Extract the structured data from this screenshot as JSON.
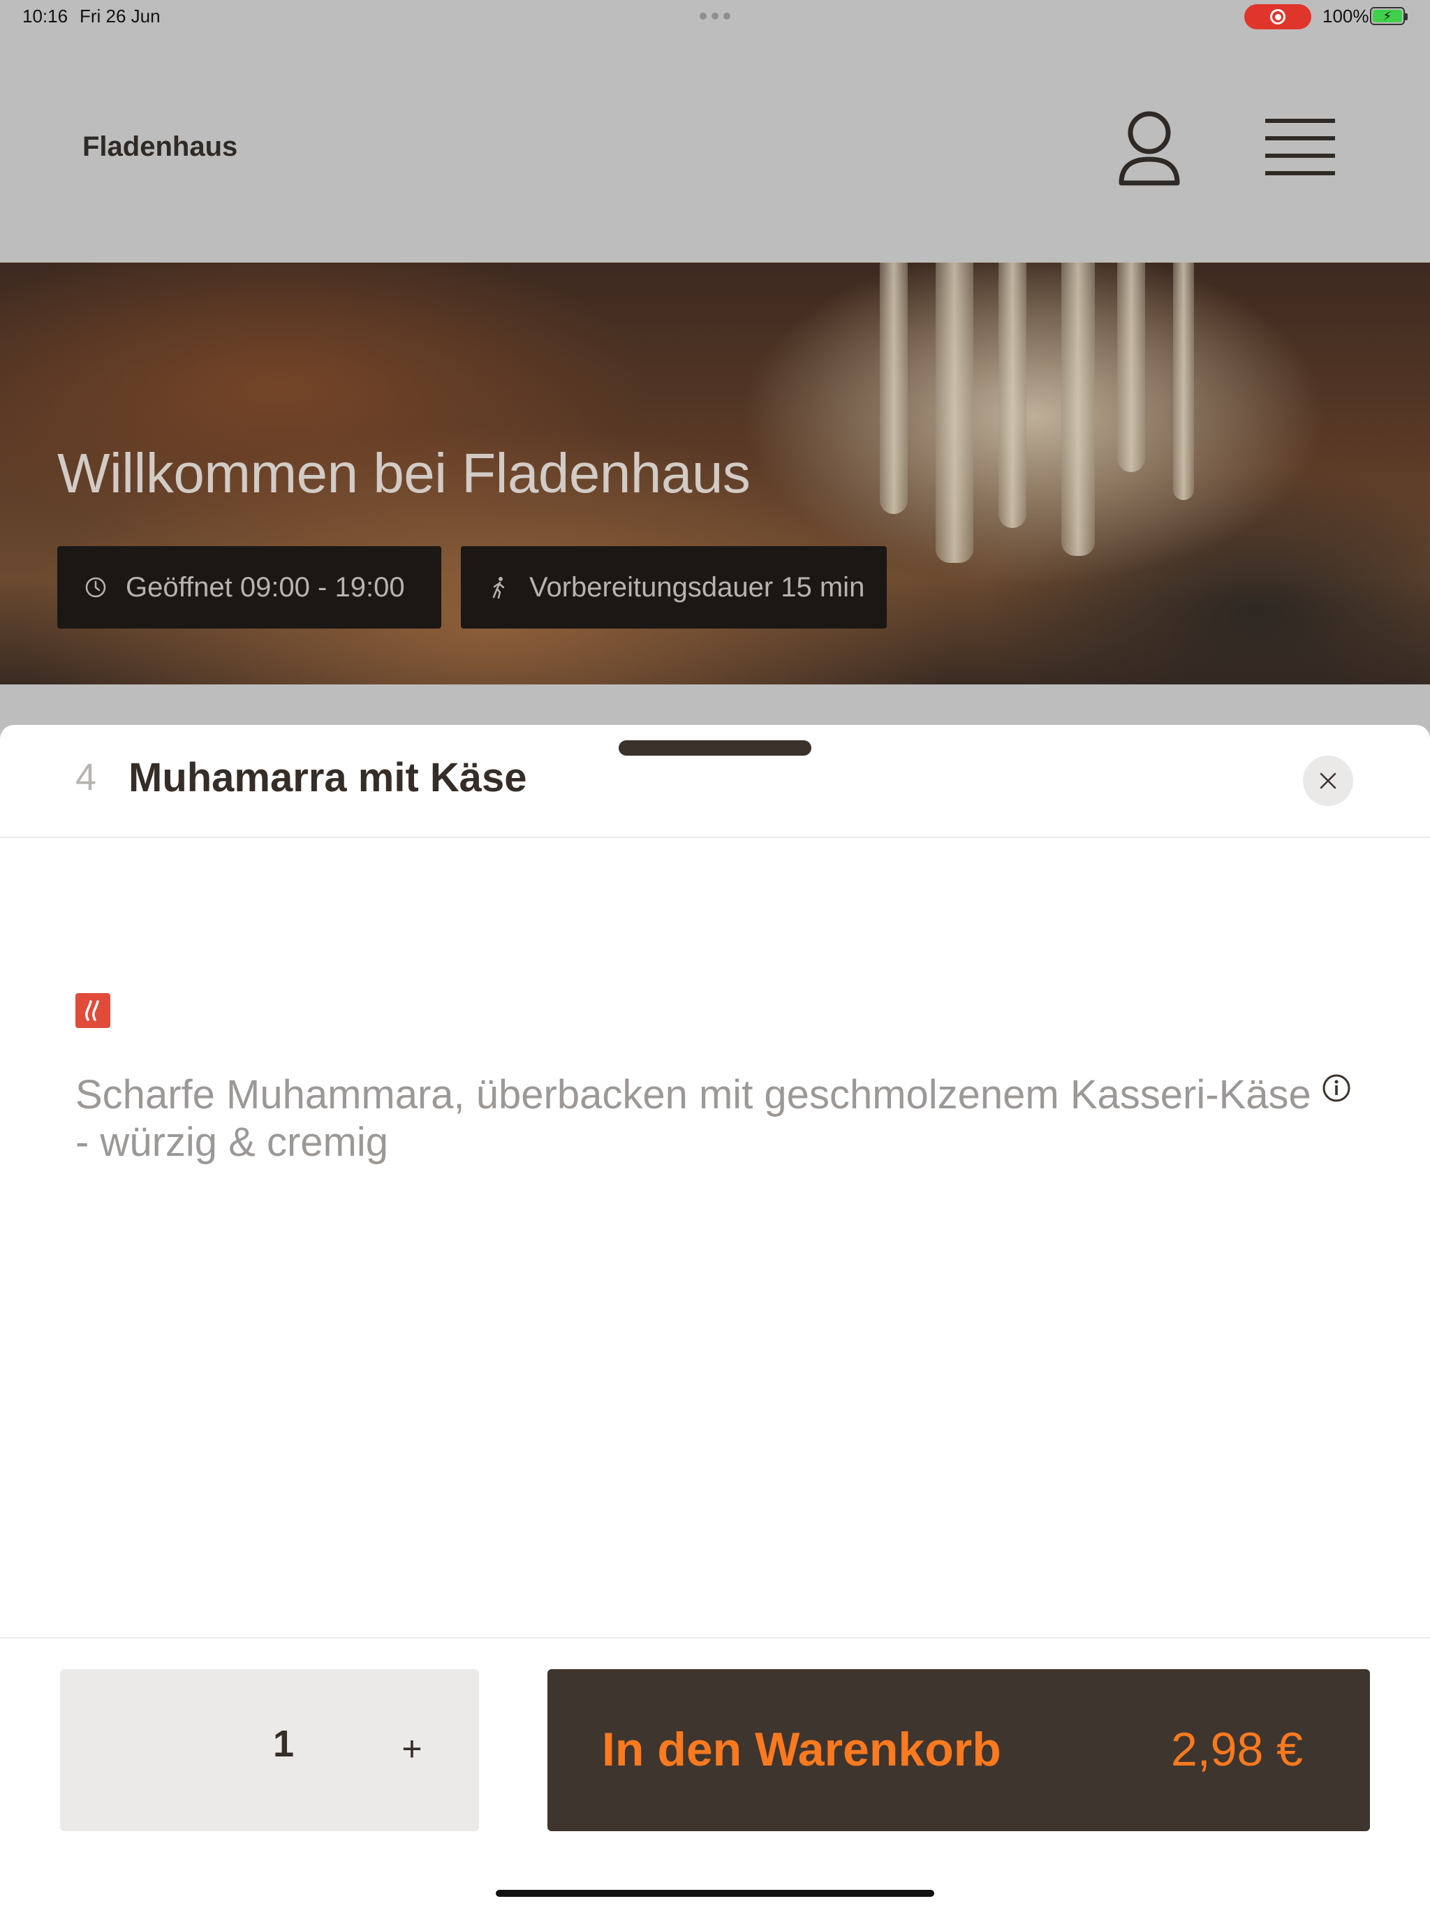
{
  "status_bar": {
    "time": "10:16",
    "date": "Fri 26 Jun",
    "battery_percent": "100%",
    "recording": true
  },
  "header": {
    "brand": "Fladenhaus",
    "icons": [
      "user-icon",
      "menu-icon"
    ]
  },
  "hero": {
    "title": "Willkommen bei Fladenhaus",
    "opening_hours": "Geöffnet 09:00 - 19:00",
    "prep_time": "Vorbereitungsdauer 15 min"
  },
  "product_sheet": {
    "number": "4",
    "title": "Muhamarra mit Käse",
    "description": "Scharfe Muhammara, überbacken mit geschmolzenem Kasseri-Käse - würzig & cremig",
    "badge_icon": "spicy-icon",
    "quantity": "1",
    "plus_label": "+",
    "add_to_cart_label": "In den Warenkorb",
    "price": "2,98 €"
  },
  "colors": {
    "accent_orange": "#ff7a1f",
    "button_dark": "#3e352f",
    "spicy_red": "#e04b3a",
    "record_red": "#e0352b"
  }
}
